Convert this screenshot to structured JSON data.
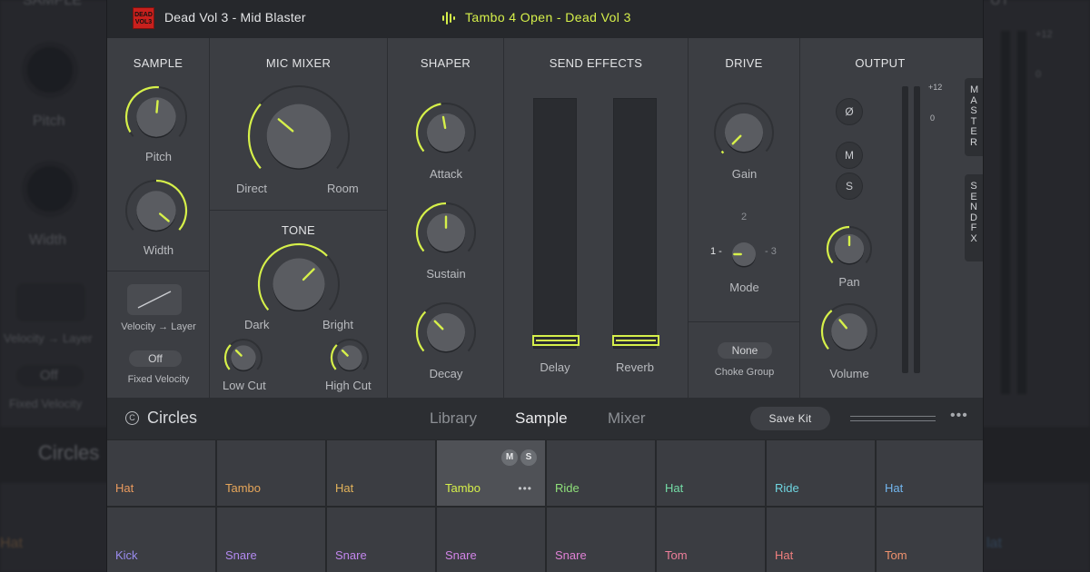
{
  "background": {
    "sample_title": "SAMPLE",
    "out_title": "UT",
    "pitch_label": "Pitch",
    "width_label": "Width",
    "vel_label": "Velocity → Layer",
    "off_label": "Off",
    "fixed_label": "Fixed Velocity",
    "circles_label": "Circles",
    "hat_left": "Hat",
    "hat_right": "lat",
    "plus12": "+12",
    "zero": "0"
  },
  "titlebar": {
    "kit_logo_text": "DEAD VOL3",
    "kit_name": "Dead Vol 3 - Mid Blaster",
    "sample_name": "Tambo 4 Open - Dead Vol 3"
  },
  "sample": {
    "title": "SAMPLE",
    "pitch_label": "Pitch",
    "width_label": "Width",
    "velocity_layer_label": "Velocity → Layer",
    "fixed_velocity_value": "Off",
    "fixed_velocity_label": "Fixed Velocity"
  },
  "mic_mixer": {
    "title": "MIC MIXER",
    "direct_label": "Direct",
    "room_label": "Room"
  },
  "tone": {
    "title": "TONE",
    "dark_label": "Dark",
    "bright_label": "Bright",
    "low_cut_label": "Low Cut",
    "high_cut_label": "High Cut"
  },
  "shaper": {
    "title": "SHAPER",
    "attack_label": "Attack",
    "sustain_label": "Sustain",
    "decay_label": "Decay"
  },
  "send_effects": {
    "title": "SEND EFFECTS",
    "delay_label": "Delay",
    "reverb_label": "Reverb",
    "delay_level": 0.0,
    "reverb_level": 0.0
  },
  "drive": {
    "title": "DRIVE",
    "gain_label": "Gain",
    "mode_label": "Mode",
    "mode_1": "1 -",
    "mode_2": "2",
    "mode_3": "- 3",
    "choke_value": "None",
    "choke_label": "Choke Group"
  },
  "output": {
    "title": "OUTPUT",
    "phase_symbol": "Ø",
    "mute": "M",
    "solo": "S",
    "pan_label": "Pan",
    "volume_label": "Volume",
    "meter_plus12": "+12",
    "meter_zero": "0"
  },
  "side_tabs": {
    "master": "MASTER",
    "send_fx": "SEND FX"
  },
  "bottom_bar": {
    "kit_icon": "C",
    "kit_title": "Circles",
    "tabs": [
      "Library",
      "Sample",
      "Mixer"
    ],
    "active_tab": "Sample",
    "save_kit": "Save Kit",
    "more": "•••"
  },
  "pads": {
    "row1": [
      {
        "label": "Hat",
        "color": "#e99a5e"
      },
      {
        "label": "Tambo",
        "color": "#e6a65a"
      },
      {
        "label": "Hat",
        "color": "#e2b25b"
      },
      {
        "label": "Tambo",
        "color": "#d6f04a",
        "selected": true,
        "m": "M",
        "s": "S",
        "dots": "•••"
      },
      {
        "label": "Ride",
        "color": "#8fe07a"
      },
      {
        "label": "Hat",
        "color": "#74dca6"
      },
      {
        "label": "Ride",
        "color": "#6fd5e0"
      },
      {
        "label": "Hat",
        "color": "#72b6ee"
      }
    ],
    "row2": [
      {
        "label": "Kick",
        "color": "#9a8cef"
      },
      {
        "label": "Snare",
        "color": "#b38af0"
      },
      {
        "label": "Snare",
        "color": "#c387ee"
      },
      {
        "label": "Snare",
        "color": "#d385e8"
      },
      {
        "label": "Snare",
        "color": "#e182d6"
      },
      {
        "label": "Tom",
        "color": "#ef7f9b"
      },
      {
        "label": "Hat",
        "color": "#f07f7e"
      },
      {
        "label": "Tom",
        "color": "#f0926e"
      }
    ]
  },
  "colors": {
    "accent": "#d6f04a",
    "panel": "#3c3e43",
    "dark": "#26282c"
  }
}
